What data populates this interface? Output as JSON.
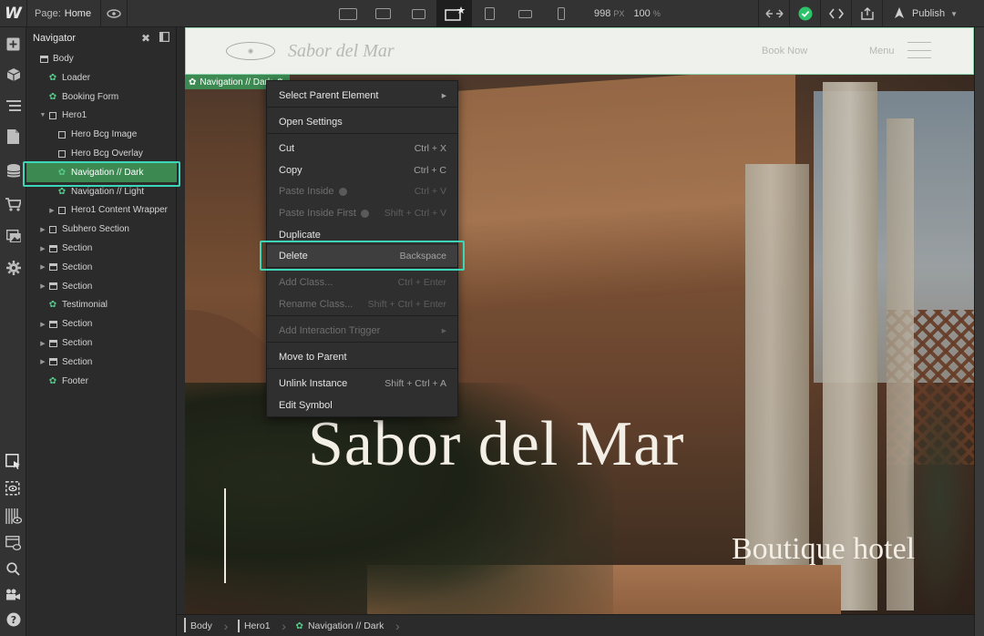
{
  "topbar": {
    "logo": "W",
    "page_label": "Page:",
    "page_value": "Home",
    "viewport_width": "998",
    "viewport_unit": "PX",
    "zoom": "100",
    "zoom_unit": "%",
    "publish_label": "Publish",
    "breakpoints": [
      "desktop-xl",
      "desktop-lg",
      "desktop",
      "base-desktop",
      "tablet",
      "mobile-landscape",
      "mobile-portrait"
    ],
    "colors": {
      "success": "#2ec36b",
      "accent": "#3dd6b8"
    }
  },
  "rail": {
    "items": [
      "add-icon",
      "components-icon",
      "navigator-icon",
      "pages-icon",
      "cms-icon",
      "ecommerce-icon",
      "assets-icon",
      "settings-icon"
    ],
    "bottom_items": [
      "select-icon",
      "preview-icon",
      "grid-icon",
      "audit-icon",
      "search-icon",
      "video-icon",
      "help-icon"
    ]
  },
  "navigator": {
    "title": "Navigator",
    "tree": [
      {
        "label": "Body",
        "type": "body",
        "depth": 0
      },
      {
        "label": "Loader",
        "type": "symbol",
        "depth": 1
      },
      {
        "label": "Booking Form",
        "type": "symbol",
        "depth": 1
      },
      {
        "label": "Hero1",
        "type": "div",
        "depth": 1,
        "expanded": true
      },
      {
        "label": "Hero Bcg Image",
        "type": "div",
        "depth": 2
      },
      {
        "label": "Hero Bcg Overlay",
        "type": "div",
        "depth": 2
      },
      {
        "label": "Navigation // Dark",
        "type": "symbol",
        "depth": 2,
        "selected": true
      },
      {
        "label": "Navigation // Light",
        "type": "symbol",
        "depth": 2
      },
      {
        "label": "Hero1 Content Wrapper",
        "type": "div",
        "depth": 2,
        "collapsed": true
      },
      {
        "label": "Subhero Section",
        "type": "div",
        "depth": 1,
        "collapsed": true
      },
      {
        "label": "Section",
        "type": "section",
        "depth": 1,
        "collapsed": true
      },
      {
        "label": "Section",
        "type": "section",
        "depth": 1,
        "collapsed": true
      },
      {
        "label": "Section",
        "type": "section",
        "depth": 1,
        "collapsed": true
      },
      {
        "label": "Testimonial",
        "type": "symbol",
        "depth": 1
      },
      {
        "label": "Section",
        "type": "section",
        "depth": 1,
        "collapsed": true
      },
      {
        "label": "Section",
        "type": "section",
        "depth": 1,
        "collapsed": true
      },
      {
        "label": "Section",
        "type": "section",
        "depth": 1,
        "collapsed": true
      },
      {
        "label": "Footer",
        "type": "symbol",
        "depth": 1
      }
    ]
  },
  "canvas": {
    "site_brand": "Sabor del Mar",
    "site_book": "Book Now",
    "site_menu": "Menu",
    "selection_tag": "Navigation // Dark",
    "hero_title": "Sabor del Mar",
    "hero_subtitle": "Boutique hotel"
  },
  "context_menu": {
    "items": [
      {
        "label": "Select Parent Element",
        "shortcut": "",
        "submenu": true,
        "disabled": false
      },
      {
        "label": "Open Settings",
        "shortcut": "",
        "disabled": false
      },
      {
        "label": "Cut",
        "shortcut": "Ctrl + X",
        "disabled": false
      },
      {
        "label": "Copy",
        "shortcut": "Ctrl + C",
        "disabled": false
      },
      {
        "label": "Paste Inside",
        "shortcut": "Ctrl + V",
        "disabled": true,
        "help": true
      },
      {
        "label": "Paste Inside First",
        "shortcut": "Shift + Ctrl + V",
        "disabled": true,
        "help": true
      },
      {
        "label": "Duplicate",
        "shortcut": "",
        "disabled": false
      },
      {
        "label": "Delete",
        "shortcut": "Backspace",
        "disabled": false,
        "highlighted": true
      },
      {
        "label": "Add Class...",
        "shortcut": "Ctrl + Enter",
        "disabled": true
      },
      {
        "label": "Rename Class...",
        "shortcut": "Shift + Ctrl + Enter",
        "disabled": true
      },
      {
        "label": "Add Interaction Trigger",
        "shortcut": "",
        "submenu": true,
        "disabled": true
      },
      {
        "label": "Move to Parent",
        "shortcut": "",
        "disabled": false
      },
      {
        "label": "Unlink Instance",
        "shortcut": "Shift + Ctrl + A",
        "disabled": false
      },
      {
        "label": "Edit Symbol",
        "shortcut": "",
        "disabled": false
      }
    ]
  },
  "breadcrumb": {
    "items": [
      {
        "label": "Body",
        "type": "body"
      },
      {
        "label": "Hero1",
        "type": "div"
      },
      {
        "label": "Navigation // Dark",
        "type": "symbol"
      }
    ]
  }
}
